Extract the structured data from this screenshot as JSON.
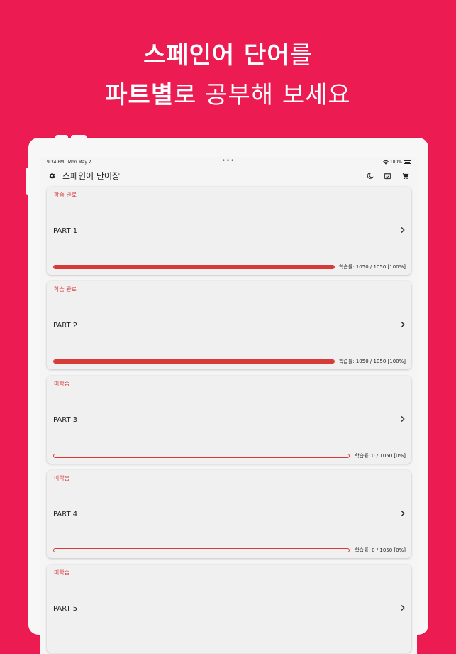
{
  "headline": {
    "line1_bold": "스페인어 단어",
    "line1_light": "를",
    "line2_bold": "파트별",
    "line2_light": "로 공부해 보세요"
  },
  "statusbar": {
    "time": "9:34 PM",
    "date": "Mon May 2",
    "dots": "•••",
    "battery": "100%"
  },
  "appbar": {
    "title": "스페인어 단어장"
  },
  "icons": {
    "settings": "gear-icon",
    "theme": "moon-icon",
    "calendar": "calendar-check-icon",
    "cart": "cart-icon",
    "wifi": "wifi-icon",
    "chevron": "chevron-right-icon"
  },
  "colors": {
    "brand": "#ec1b52",
    "progress": "#d83a3a"
  },
  "parts": [
    {
      "status": "학습 완료",
      "title": "PART 1",
      "progress": 1.0,
      "rate": "학습률: 1050 / 1050 [100%]"
    },
    {
      "status": "학습 완료",
      "title": "PART 2",
      "progress": 1.0,
      "rate": "학습률: 1050 / 1050 [100%]"
    },
    {
      "status": "미학습",
      "title": "PART 3",
      "progress": 0.0,
      "rate": "학습률: 0 / 1050 [0%]"
    },
    {
      "status": "미학습",
      "title": "PART 4",
      "progress": 0.0,
      "rate": "학습률: 0 / 1050 [0%]"
    },
    {
      "status": "미학습",
      "title": "PART 5",
      "progress": 0.0,
      "rate": ""
    }
  ]
}
